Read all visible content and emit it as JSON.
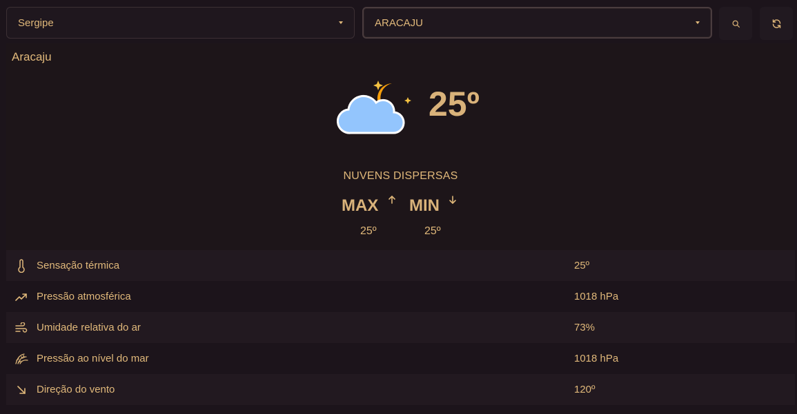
{
  "controls": {
    "state_value": "Sergipe",
    "city_value": "ARACAJU"
  },
  "weather": {
    "city": "Aracaju",
    "temperature": "25º",
    "description": "NUVENS DISPERSAS",
    "max_label": "MAX",
    "min_label": "MIN",
    "max_value": "25º",
    "min_value": "25º",
    "icon": "cloud-moon-icon"
  },
  "details": [
    {
      "icon": "thermometer-icon",
      "label": "Sensação térmica",
      "value": "25º"
    },
    {
      "icon": "trending-up-icon",
      "label": "Pressão atmosférica",
      "value": "1018 hPa"
    },
    {
      "icon": "wind-icon",
      "label": "Umidade relativa do ar",
      "value": "73%"
    },
    {
      "icon": "wave-icon",
      "label": "Pressão ao nível do mar",
      "value": "1018 hPa"
    },
    {
      "icon": "arrow-down-right-icon",
      "label": "Direção do vento",
      "value": "120º"
    }
  ],
  "colors": {
    "background": "#1c141b",
    "accent": "#e0b87a",
    "cloud": "#93c5fd",
    "moon": "#f59e0b"
  }
}
